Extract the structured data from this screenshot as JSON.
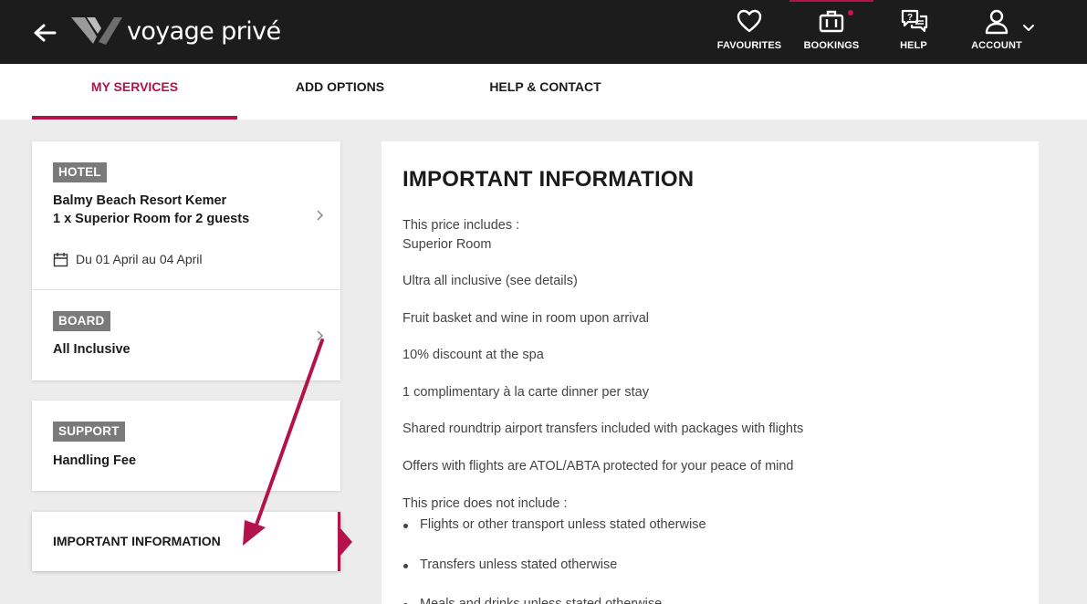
{
  "header": {
    "logo_text": "voyage privé",
    "nav": [
      {
        "label": "FAVOURITES"
      },
      {
        "label": "BOOKINGS"
      },
      {
        "label": "HELP"
      },
      {
        "label": "ACCOUNT"
      }
    ],
    "colors": {
      "background": "#1c1c1c",
      "accent": "#b3124a"
    }
  },
  "tabs": [
    {
      "label": "MY SERVICES",
      "active": true
    },
    {
      "label": "ADD OPTIONS",
      "active": false
    },
    {
      "label": "HELP & CONTACT",
      "active": false
    }
  ],
  "hotel_card": {
    "badge": "HOTEL",
    "name": "Balmy Beach Resort Kemer",
    "room": "1 x Superior Room for 2 guests",
    "dates": "Du 01 April au 04 April"
  },
  "board_card": {
    "badge": "BOARD",
    "value": "All Inclusive"
  },
  "support_card": {
    "badge": "SUPPORT",
    "value": "Handling Fee"
  },
  "info_card": {
    "label": "IMPORTANT INFORMATION"
  },
  "panel": {
    "title": "IMPORTANT INFORMATION",
    "includes_heading": "This price includes :",
    "includes": [
      "Superior Room",
      "Ultra all inclusive (see details)",
      "Fruit basket and wine in room upon arrival",
      "10% discount at the spa",
      "1 complimentary à la carte dinner per stay",
      "Shared roundtrip airport transfers included with packages with flights",
      "Offers with flights are ATOL/ABTA protected for your peace of mind"
    ],
    "excludes_heading": "This price does not include :",
    "excludes": [
      "Flights or other transport unless stated otherwise",
      "Transfers unless stated otherwise",
      "Meals and drinks unless stated otherwise"
    ]
  }
}
